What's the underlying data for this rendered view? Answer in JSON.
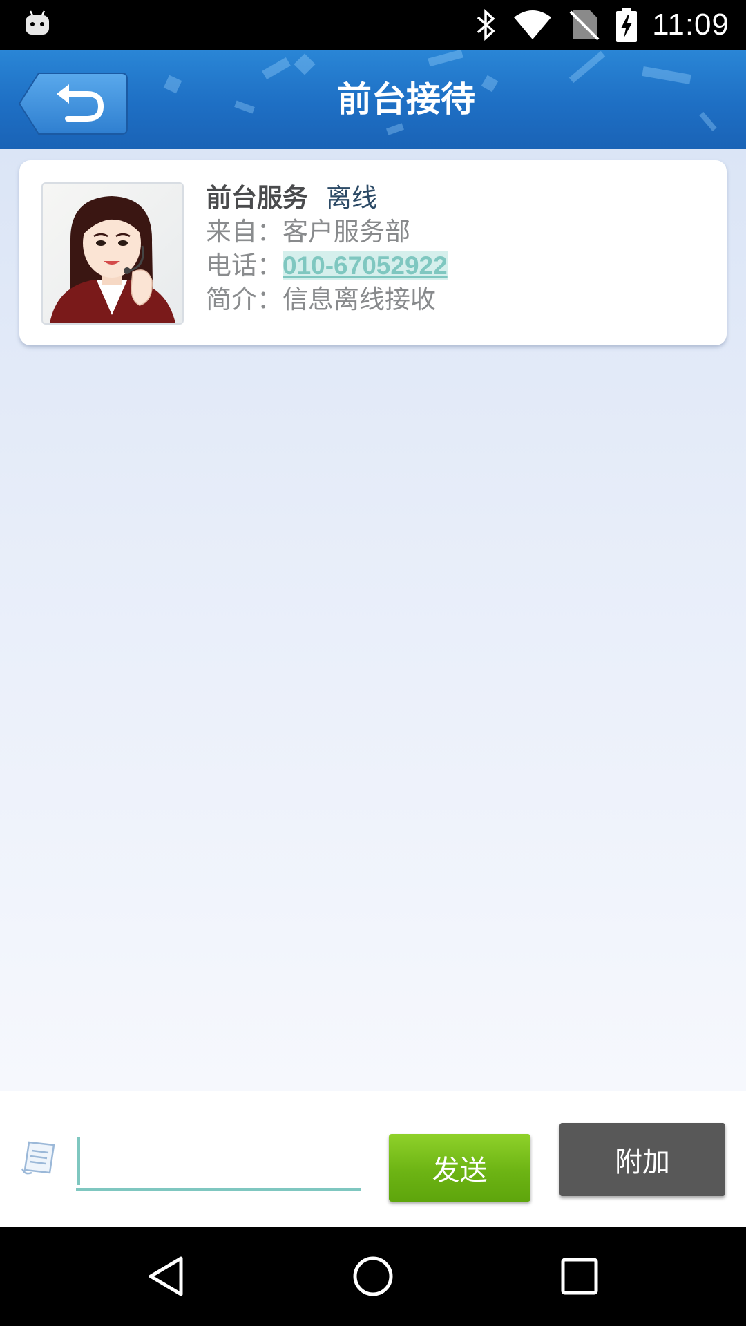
{
  "status_bar": {
    "time": "11:09",
    "icons": [
      "android-debug-icon",
      "bluetooth-icon",
      "wifi-icon",
      "no-sim-icon",
      "battery-charging-icon"
    ]
  },
  "header": {
    "title": "前台接待",
    "back_icon": "undo-arrow-icon"
  },
  "contact": {
    "name": "前台服务",
    "status": "离线",
    "from_label": "来自：",
    "from_value": "客户服务部",
    "phone_label": "电话：",
    "phone_value": "010-67052922",
    "intro_label": "简介：",
    "intro_value": "信息离线接收"
  },
  "composer": {
    "input_value": "",
    "input_placeholder": "",
    "send_label": "发送",
    "attach_label": "附加",
    "note_icon": "note-icon",
    "accent_color": "#7fc7c0",
    "send_color": "#6db414"
  },
  "nav_bar": {
    "buttons": [
      "back-icon",
      "home-icon",
      "recents-icon"
    ]
  }
}
